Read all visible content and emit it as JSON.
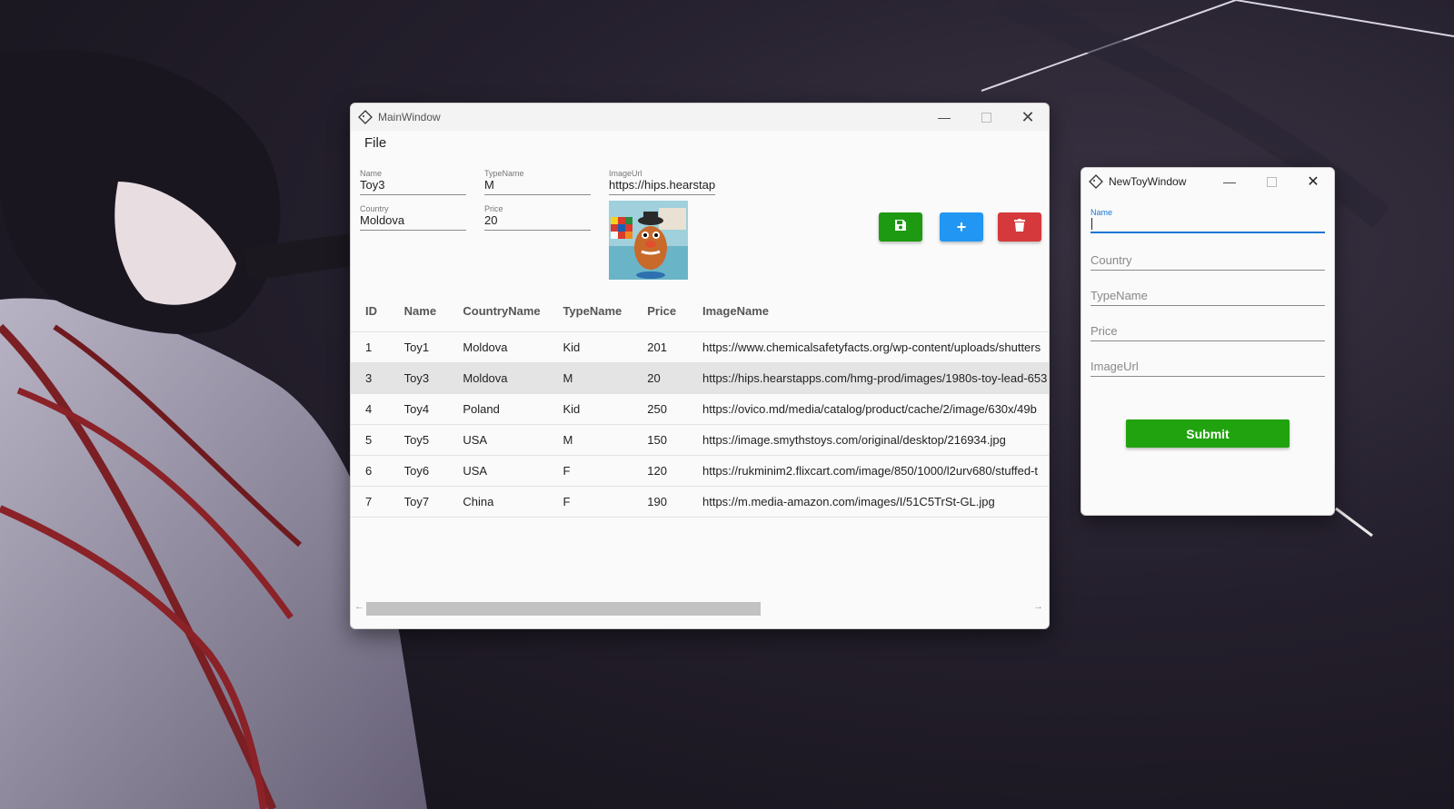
{
  "main_window": {
    "title": "MainWindow",
    "menu": {
      "file_label": "File"
    },
    "form": {
      "name_label": "Name",
      "name_value": "Toy3",
      "country_label": "Country",
      "country_value": "Moldova",
      "typename_label": "TypeName",
      "typename_value": "M",
      "price_label": "Price",
      "price_value": "20",
      "imageurl_label": "ImageUrl",
      "imageurl_value": "https://hips.hearstap"
    },
    "buttons": {
      "save_icon": "save-icon",
      "add_label": "+",
      "delete_icon": "trash-icon"
    },
    "table": {
      "headers": [
        "ID",
        "Name",
        "CountryName",
        "TypeName",
        "Price",
        "ImageName"
      ],
      "rows": [
        [
          "1",
          "Toy1",
          "Moldova",
          "Kid",
          "201",
          "https://www.chemicalsafetyfacts.org/wp-content/uploads/shutters"
        ],
        [
          "3",
          "Toy3",
          "Moldova",
          "M",
          "20",
          "https://hips.hearstapps.com/hmg-prod/images/1980s-toy-lead-653"
        ],
        [
          "4",
          "Toy4",
          "Poland",
          "Kid",
          "250",
          "https://ovico.md/media/catalog/product/cache/2/image/630x/49b"
        ],
        [
          "5",
          "Toy5",
          "USA",
          "M",
          "150",
          "https://image.smythstoys.com/original/desktop/216934.jpg"
        ],
        [
          "6",
          "Toy6",
          "USA",
          "F",
          "120",
          "https://rukminim2.flixcart.com/image/850/1000/l2urv680/stuffed-t"
        ],
        [
          "7",
          "Toy7",
          "China",
          "F",
          "190",
          "https://m.media-amazon.com/images/I/51C5TrSt-GL.jpg"
        ]
      ],
      "selected_row_index": 1
    }
  },
  "new_toy_window": {
    "title": "NewToyWindow",
    "name_label": "Name",
    "name_value": "",
    "country_placeholder": "Country",
    "typename_placeholder": "TypeName",
    "price_placeholder": "Price",
    "imageurl_placeholder": "ImageUrl",
    "submit_label": "Submit"
  },
  "colors": {
    "save_button": "#1e9a12",
    "add_button": "#2196f3",
    "delete_button": "#d5393b",
    "submit_button": "#21a30f",
    "focus_accent": "#1976d2"
  }
}
